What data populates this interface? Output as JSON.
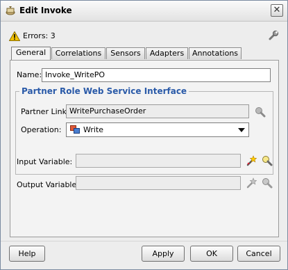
{
  "window": {
    "title": "Edit Invoke",
    "close_label": "✕"
  },
  "errors": {
    "text": "Errors: 3"
  },
  "tabs": [
    {
      "label": "General",
      "active": true
    },
    {
      "label": "Correlations"
    },
    {
      "label": "Sensors"
    },
    {
      "label": "Adapters"
    },
    {
      "label": "Annotations"
    }
  ],
  "general": {
    "name_label": "Name:",
    "name_value": "Invoke_WritePO",
    "partner_group": {
      "title": "Partner Role Web Service Interface",
      "partner_link_label": "Partner Link:",
      "partner_link_value": "WritePurchaseOrder",
      "operation_label": "Operation:",
      "operation_value": "Write"
    },
    "input_variable_label": "Input Variable:",
    "input_variable_value": "",
    "output_variable_label": "Output Variable:",
    "output_variable_value": ""
  },
  "buttons": {
    "help": "Help",
    "apply": "Apply",
    "ok": "OK",
    "cancel": "Cancel"
  },
  "colors": {
    "group_title": "#2a5aa8",
    "warning": "#f2c200"
  }
}
